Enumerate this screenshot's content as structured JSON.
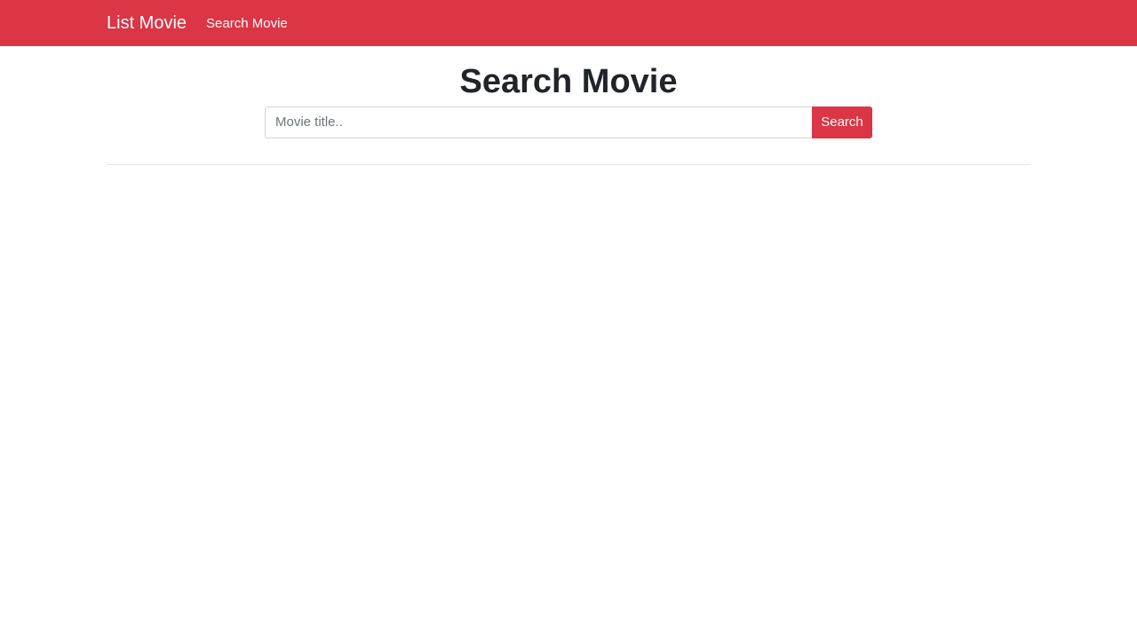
{
  "navbar": {
    "brand": "List Movie",
    "links": [
      {
        "label": "Search Movie"
      }
    ],
    "color": "#dc3545"
  },
  "main": {
    "title": "Search Movie",
    "search": {
      "placeholder": "Movie title..",
      "value": "",
      "button_label": "Search"
    },
    "results": []
  }
}
